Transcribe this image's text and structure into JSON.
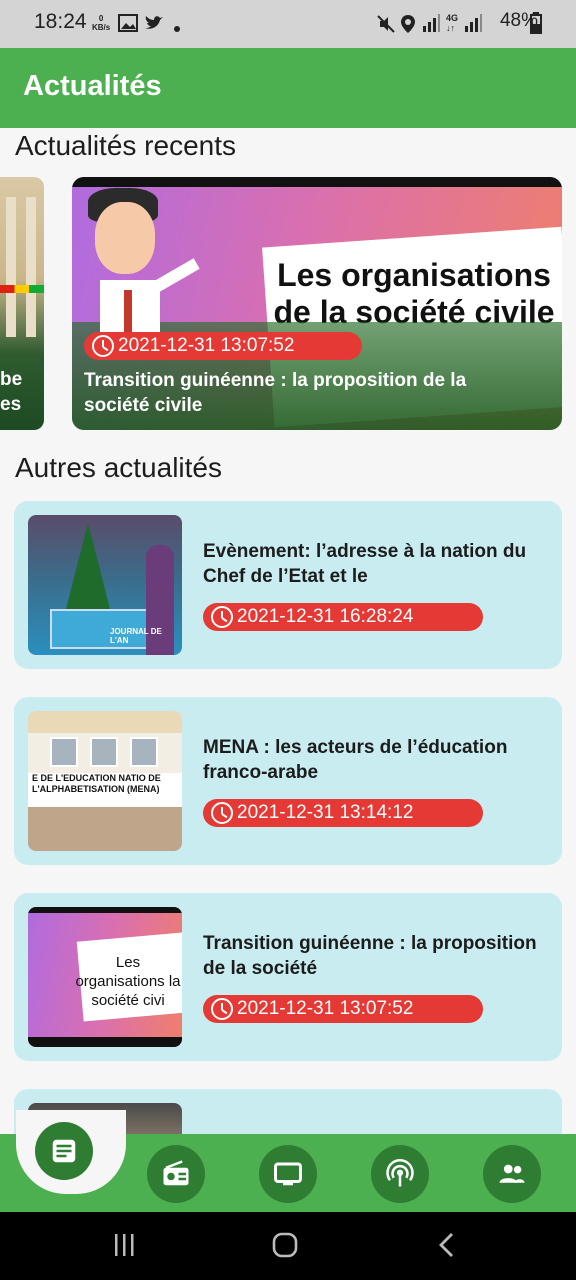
{
  "status_bar": {
    "time": "18:24",
    "net_speed": "0\nKB/s",
    "battery": "48%"
  },
  "app_bar": {
    "title": "Actualités"
  },
  "sections": {
    "recent_title": "Actualités recents",
    "others_title": "Autres actualités"
  },
  "carousel": {
    "partial_card": {
      "line1": "be",
      "line2": "es"
    },
    "main_card": {
      "board_text": "Les organisations de la société civile",
      "date": "2021-12-31 13:07:52",
      "title": "Transition guinéenne : la proposition de la société civile"
    }
  },
  "news_list": [
    {
      "title": "Evènement: l’adresse à la nation du Chef de l’Etat et le",
      "date": "2021-12-31 16:28:24",
      "thumb_label": "JOURNAL DE L'AN"
    },
    {
      "title": "MENA : les acteurs de l’éducation franco-arabe",
      "date": "2021-12-31 13:14:12",
      "thumb_label": "E DE L'EDUCATION NATIO DE L'ALPHABETISATION (MENA)"
    },
    {
      "title": "Transition guinéenne : la proposition de la société",
      "date": "2021-12-31 13:07:52",
      "thumb_label": "Les organisations la société civi"
    }
  ],
  "bottom_nav": [
    {
      "name": "news",
      "icon": "article-icon",
      "active": true
    },
    {
      "name": "radio",
      "icon": "radio-icon",
      "active": false
    },
    {
      "name": "tv",
      "icon": "tv-icon",
      "active": false
    },
    {
      "name": "podcast",
      "icon": "podcast-icon",
      "active": false
    },
    {
      "name": "community",
      "icon": "people-icon",
      "active": false
    }
  ],
  "colors": {
    "primary": "#4caf50",
    "primary_dark": "#2e7d32",
    "chip_red": "#e53935",
    "card_bg": "#c8ecf0"
  }
}
